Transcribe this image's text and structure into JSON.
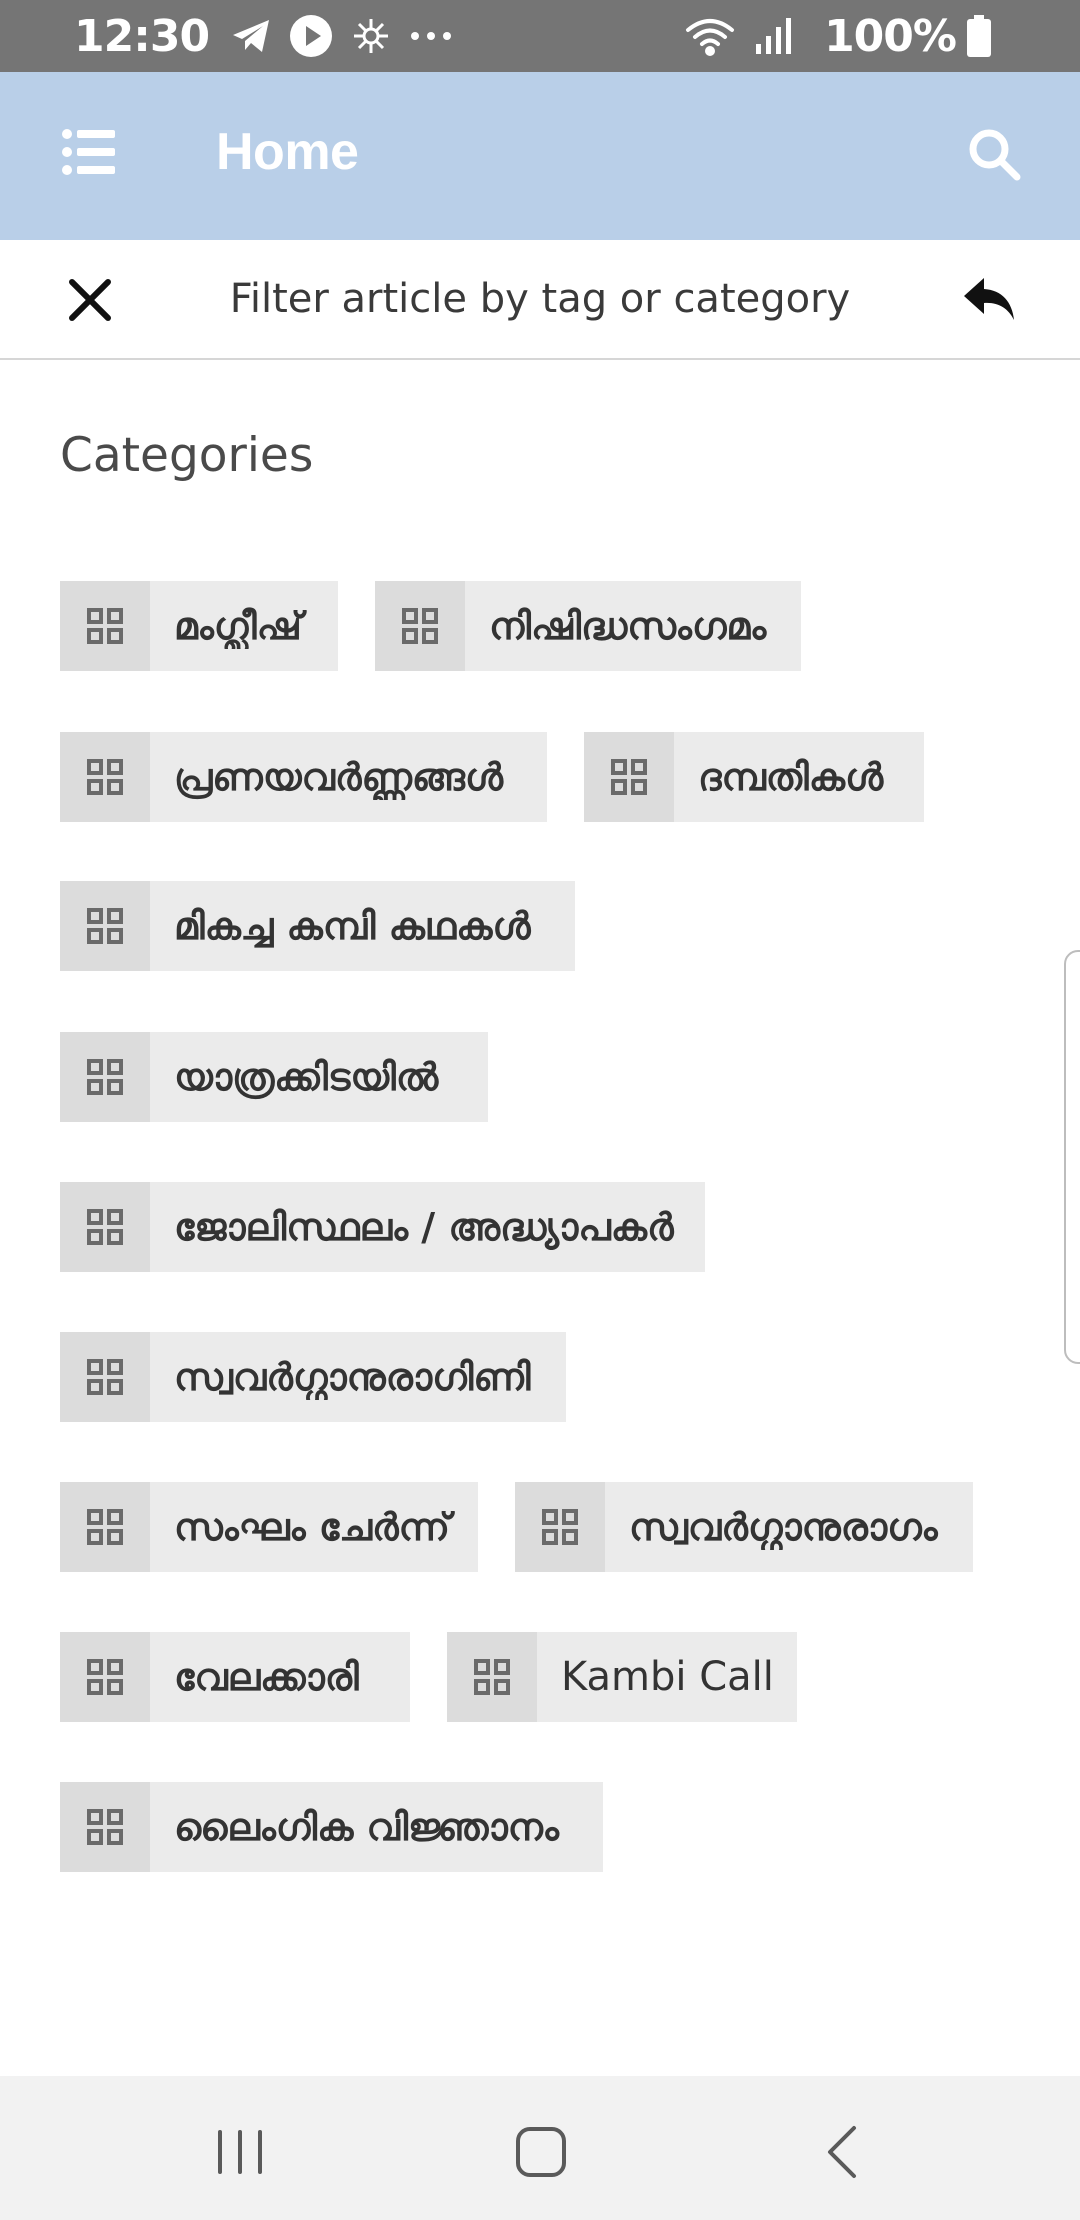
{
  "status_bar": {
    "time": "12:30",
    "battery": "100%",
    "icons": [
      "telegram-icon",
      "play-icon",
      "sparkle-icon",
      "more-dots-icon",
      "wifi-icon",
      "signal-icon",
      "battery-icon"
    ]
  },
  "app_bar": {
    "title": "Home",
    "background": "#b9cfe8",
    "menu_icon": "list-icon",
    "search_icon": "search-icon"
  },
  "filter_bar": {
    "title": "Filter article by tag or category",
    "close_icon": "close-icon",
    "back_icon": "reply-icon"
  },
  "categories": {
    "heading": "Categories",
    "items": [
      {
        "label": "മംഗ്ലീഷ്",
        "icon": "grid-icon"
      },
      {
        "label": "നിഷിദ്ധസംഗമം",
        "icon": "grid-icon"
      },
      {
        "label": "പ്രണയവർണ്ണങ്ങൾ",
        "icon": "grid-icon"
      },
      {
        "label": "ദമ്പതികൾ",
        "icon": "grid-icon"
      },
      {
        "label": "മികച്ച കമ്പി കഥകൾ",
        "icon": "grid-icon"
      },
      {
        "label": "യാത്രക്കിടയിൽ",
        "icon": "grid-icon"
      },
      {
        "label": "ജോലിസ്ഥലം / അദ്ധ്യാപകർ",
        "icon": "grid-icon"
      },
      {
        "label": "സ്വവർഗ്ഗാനുരാഗിണി",
        "icon": "grid-icon"
      },
      {
        "label": "സംഘം ചേർന്ന്",
        "icon": "grid-icon"
      },
      {
        "label": "സ്വവർഗ്ഗാനുരാഗം",
        "icon": "grid-icon"
      },
      {
        "label": "വേലക്കാരി",
        "icon": "grid-icon"
      },
      {
        "label": "Kambi Call",
        "icon": "grid-icon"
      },
      {
        "label": "ലൈംഗിക വിജ്ഞാനം",
        "icon": "grid-icon"
      }
    ]
  },
  "nav_bar": {
    "icons": [
      "recents-icon",
      "home-icon",
      "back-icon"
    ]
  }
}
